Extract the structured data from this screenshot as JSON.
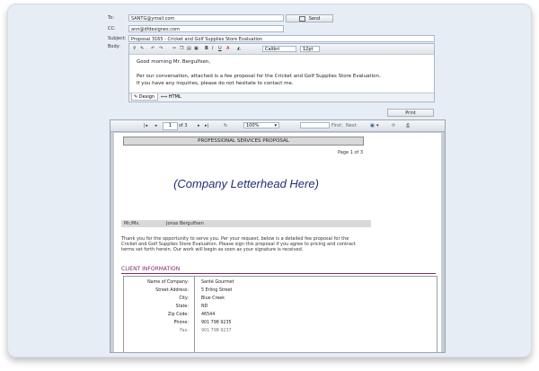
{
  "compose": {
    "to_label": "To:",
    "to_value": "SANTG@ymail.com",
    "send_label": "Send",
    "cc_label": "CC:",
    "cc_value": "ann@dfdesignes.com",
    "subject_label": "Subject:",
    "subject_value": "Proposal 3165 - Cricket and Golf Supplies Store Evaluation",
    "body_label": "Body:",
    "toolbar": {
      "font_name": "Calibri",
      "font_size": "12pt",
      "bold": "B",
      "italic": "I",
      "underline": "U",
      "text_color": "A"
    },
    "body_lines": [
      "Good morning Mr. Bergulfsen,",
      "Per our conversation, attached is a fee proposal for the Cricket and Golf Supplies Store Evaluation.",
      "If you have any inquiries, please do not hesitate to contact me."
    ],
    "design_tab": "Design",
    "html_tab": "HTML"
  },
  "print_label": "Print",
  "viewer": {
    "page_current": "1",
    "page_of": "of 3",
    "zoom": "100%",
    "find_label": "Find",
    "next_label": "Next"
  },
  "doc": {
    "title": "PROFESSIONAL SERVICES PROPOSAL",
    "page_label": "Page 1 of 3",
    "letterhead": "(Company Letterhead Here)",
    "salutation_label": "Mr./Ms.",
    "salutation_name": "Jonas Bergulfsen",
    "intro_lines": [
      "Thank you for the opportunity to serve you. Per your request, below is a detailed fee proposal for the",
      "Cricket and Golf Supplies Store Evaluation. Please sign this proposal if you agree to pricing and contract",
      "terms set forth herein. Our work will begin as soon as your signature is received."
    ],
    "client_heading": "CLIENT INFORMATION",
    "client_rows": [
      {
        "k": "Name of Company:",
        "v": "Santé Gourmet"
      },
      {
        "k": "Street Address:",
        "v": "5 Erling Street"
      },
      {
        "k": "City:",
        "v": "Blue Creek"
      },
      {
        "k": "State:",
        "v": "ND"
      },
      {
        "k": "Zip Code:",
        "v": "46544"
      },
      {
        "k": "Phone:",
        "v": "901 798 9235"
      },
      {
        "k": "Fax:",
        "v": "901 798 9237"
      }
    ]
  },
  "colors": {
    "accent": "#7a2a6e",
    "letterhead_text": "#1e2e7a"
  }
}
